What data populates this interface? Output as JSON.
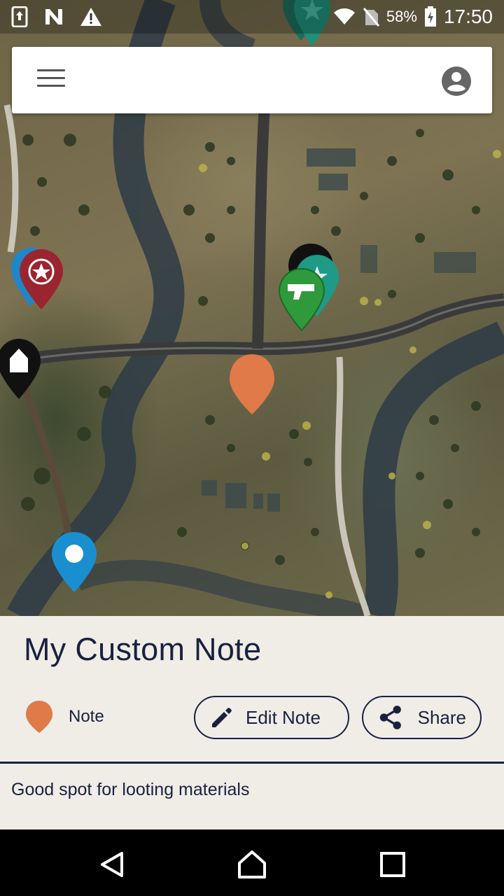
{
  "status_bar": {
    "battery_percent": "58%",
    "time": "17:50",
    "icons": [
      "screen-rotation-icon",
      "n-notification-icon",
      "warning-icon",
      "wifi-icon",
      "no-sim-icon",
      "battery-charging-icon"
    ]
  },
  "search_bar": {
    "menu_icon": "hamburger-menu-icon",
    "account_icon": "account-circle-icon"
  },
  "map": {
    "pins": [
      {
        "name": "teal-star-pin-top",
        "color": "#1f8f78",
        "icon": "star-icon"
      },
      {
        "name": "blue-pin-left",
        "color": "#1e87c8",
        "icon": "pin-icon"
      },
      {
        "name": "red-star-pin",
        "color": "#9a2530",
        "icon": "star-icon"
      },
      {
        "name": "black-house-pin",
        "color": "#111111",
        "icon": "house-icon"
      },
      {
        "name": "black-pin-cluster",
        "color": "#111111",
        "icon": "pin-icon"
      },
      {
        "name": "teal-star-pin-cluster",
        "color": "#1f9a86",
        "icon": "star-icon"
      },
      {
        "name": "green-gun-pin",
        "color": "#2e9a3c",
        "icon": "gun-icon"
      },
      {
        "name": "orange-note-pin",
        "color": "#e07a48",
        "icon": "note-icon"
      },
      {
        "name": "blue-dot-pin",
        "color": "#1a8fd0",
        "icon": "dot-icon"
      }
    ]
  },
  "note": {
    "title": "My Custom Note",
    "category_label": "Note",
    "category_color": "#e07a48",
    "edit_label": "Edit Note",
    "share_label": "Share",
    "description": "Good spot for looting materials",
    "text_color": "#1a2140"
  },
  "nav_bar": {
    "buttons": [
      "back-icon",
      "home-icon",
      "recents-icon"
    ]
  }
}
